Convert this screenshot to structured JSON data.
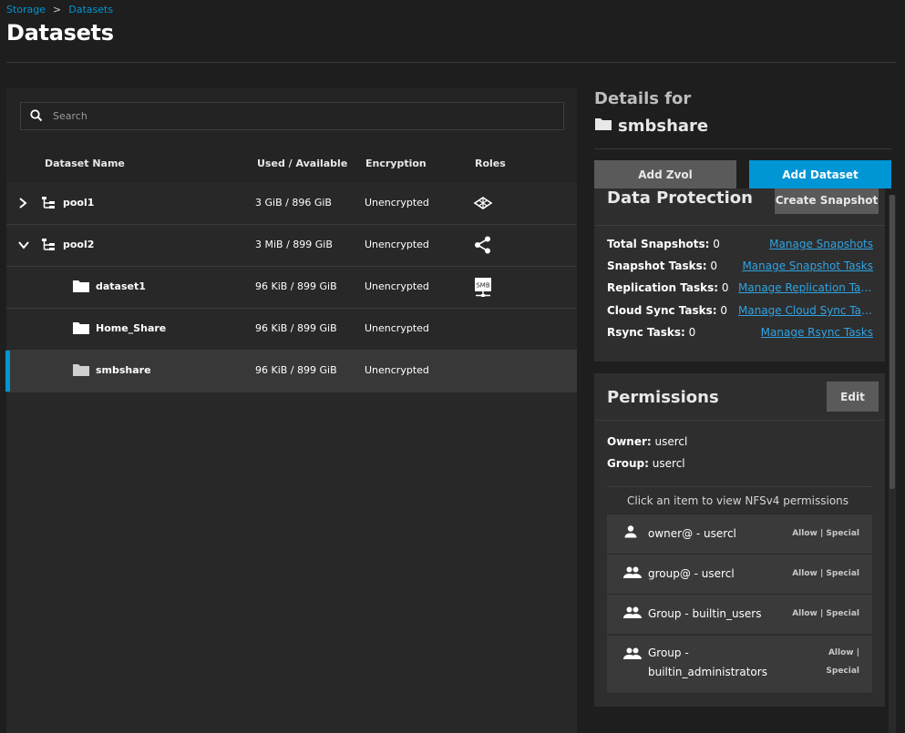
{
  "breadcrumb": {
    "root": "Storage",
    "separator": ">",
    "current": "Datasets"
  },
  "page_title": "Datasets",
  "search": {
    "placeholder": "Search",
    "value": ""
  },
  "table": {
    "headers": {
      "name": "Dataset Name",
      "used": "Used / Available",
      "encryption": "Encryption",
      "roles": "Roles"
    },
    "rows": [
      {
        "name": "pool1",
        "used": "3 GiB / 896 GiB",
        "encryption": "Unencrypted",
        "expand": "chevron-right-icon",
        "role_icon": "dataset-roles-icon"
      },
      {
        "name": "pool2",
        "used": "3 MiB / 899 GiB",
        "encryption": "Unencrypted",
        "expand": "chevron-down-icon",
        "role_icon": "share-icon"
      },
      {
        "name": "dataset1",
        "used": "96 KiB / 899 GiB",
        "encryption": "Unencrypted",
        "role_icon": "smb-share-icon",
        "role_text": "SMB"
      },
      {
        "name": "Home_Share",
        "used": "96 KiB / 899 GiB",
        "encryption": "Unencrypted"
      },
      {
        "name": "smbshare",
        "used": "96 KiB / 899 GiB",
        "encryption": "Unencrypted",
        "selected": true
      }
    ]
  },
  "details": {
    "heading": "Details for",
    "dataset_name": "smbshare",
    "buttons": {
      "add_zvol": "Add Zvol",
      "add_dataset": "Add Dataset"
    },
    "protection": {
      "title": "Data Protection",
      "create_snapshot": "Create Snapshot",
      "items": [
        {
          "label": "Total Snapshots:",
          "value": "0",
          "link": "Manage Snapshots"
        },
        {
          "label": "Snapshot Tasks:",
          "value": "0",
          "link": "Manage Snapshot Tasks"
        },
        {
          "label": "Replication Tasks:",
          "value": "0",
          "link": "Manage Replication Tasks"
        },
        {
          "label": "Cloud Sync Tasks:",
          "value": "0",
          "link": "Manage Cloud Sync Tasks"
        },
        {
          "label": "Rsync Tasks:",
          "value": "0",
          "link": "Manage Rsync Tasks"
        }
      ]
    },
    "permissions": {
      "title": "Permissions",
      "edit": "Edit",
      "owner_label": "Owner:",
      "owner": "usercl",
      "group_label": "Group:",
      "group": "usercl",
      "hint": "Click an item to view NFSv4 permissions",
      "aces": [
        {
          "who": "owner@ - usercl",
          "perm": "Allow | Special",
          "icon": "user-icon"
        },
        {
          "who": "group@ - usercl",
          "perm": "Allow | Special",
          "icon": "group-icon"
        },
        {
          "who": "Group - builtin_users",
          "perm": "Allow | Special",
          "icon": "group-icon"
        },
        {
          "who_line1": "Group -",
          "who_line2": "builtin_administrators",
          "perm_line1": "Allow |",
          "perm_line2": "Special",
          "icon": "group-icon"
        }
      ]
    }
  },
  "colors": {
    "accent": "#0095d5",
    "link": "#2fa3e3",
    "background": "#1e1e1e",
    "panel": "#282828",
    "card": "#2e2e2e"
  }
}
